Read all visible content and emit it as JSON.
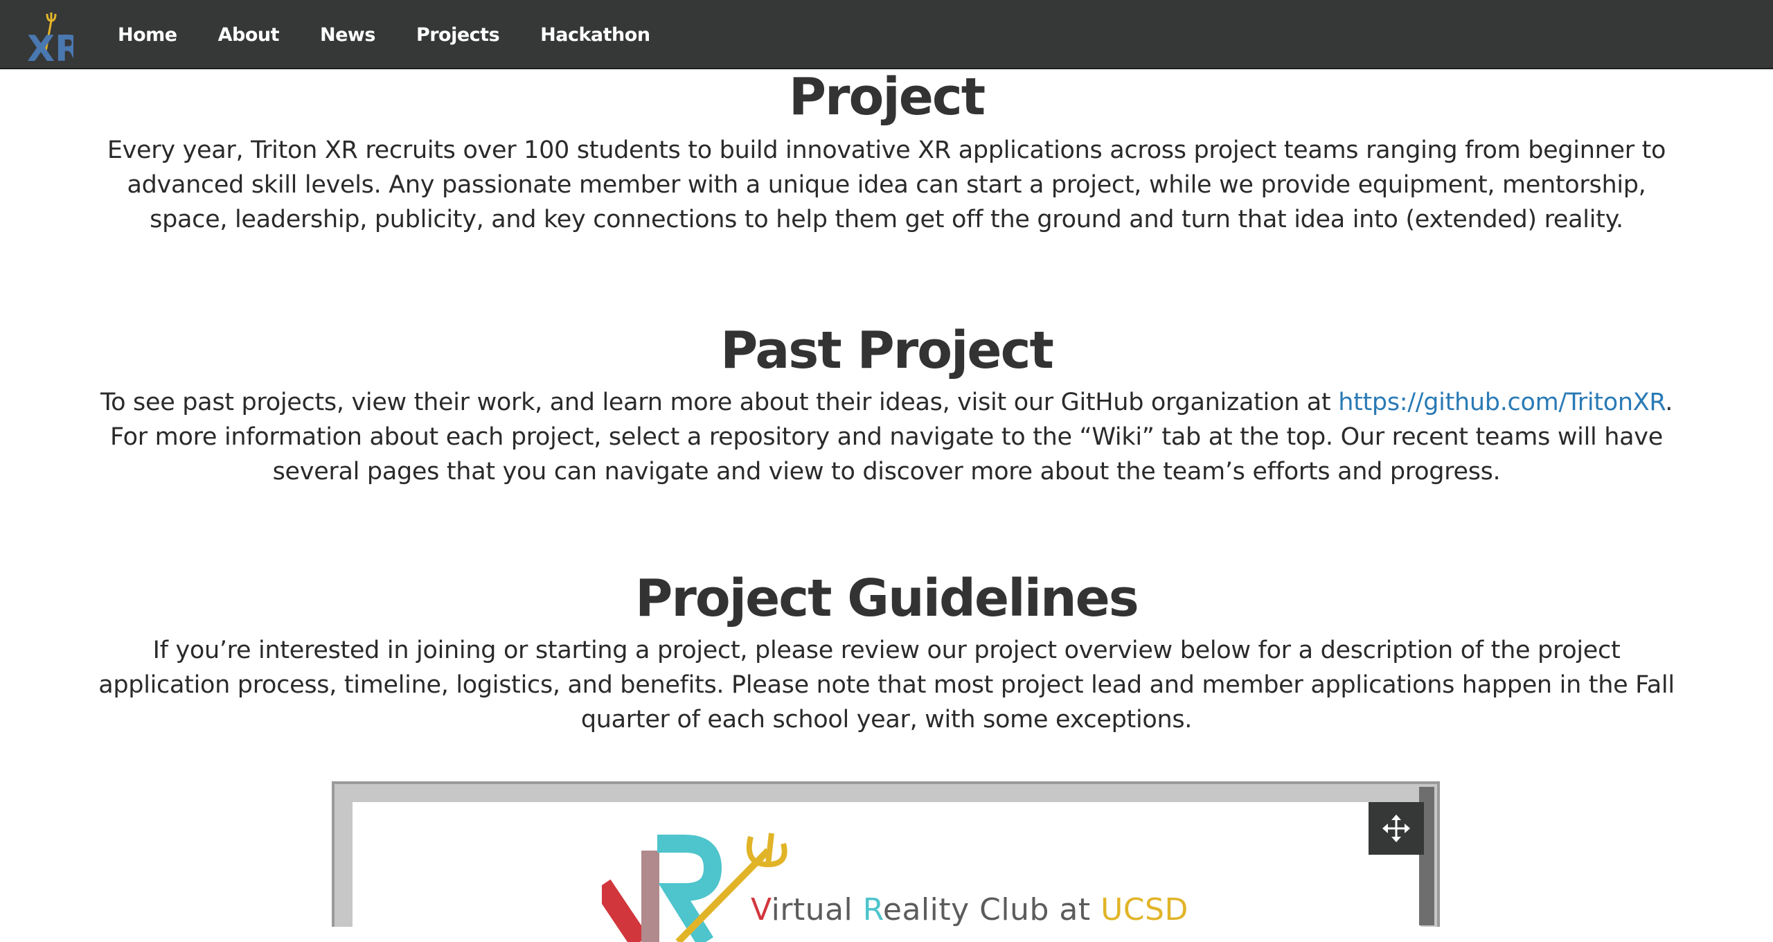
{
  "nav": {
    "logo_text": "XR",
    "links": [
      "Home",
      "About",
      "News",
      "Projects",
      "Hackathon"
    ]
  },
  "sections": {
    "project": {
      "title": "Project",
      "body": "Every year, Triton XR recruits over 100 students to build innovative XR applications across project teams ranging from beginner to advanced skill levels. Any passionate member with a unique idea can start a project, while we provide equipment, mentorship, space, leadership, publicity, and key connections to help them get off the ground and turn that idea into (extended) reality."
    },
    "past_project": {
      "title": "Past Project",
      "body_before": "To see past projects, view their work, and learn more about their ideas, visit our GitHub organization at ",
      "link_text": "https://github.com/TritonXR",
      "body_after": ". For more information about each project, select a repository and navigate to the “Wiki” tab at the top. Our recent teams will have several pages that you can navigate and view to discover more about the team’s efforts and progress."
    },
    "guidelines": {
      "title": "Project Guidelines",
      "body": "If you’re interested in joining or starting a project, please review our project overview below for a description of the project application process, timeline, logistics, and benefits. Please note that most project lead and member applications happen in the Fall quarter of each school year, with some exceptions."
    }
  },
  "embed": {
    "slide_title_v": "V",
    "slide_title_1": "irtual ",
    "slide_title_r": "R",
    "slide_title_2": "eality Club at ",
    "slide_title_ucsd": "UCSD",
    "move_icon": "move-arrows-icon",
    "colors": {
      "red": "#d2363d",
      "teal": "#4ec4cc",
      "gold": "#e1b428",
      "mauve": "#b08a8c"
    }
  },
  "colors": {
    "navbar": "#363737",
    "link": "#2a7ab5",
    "logo_gold": "#e4b42a",
    "logo_blue": "#4a78b0"
  }
}
